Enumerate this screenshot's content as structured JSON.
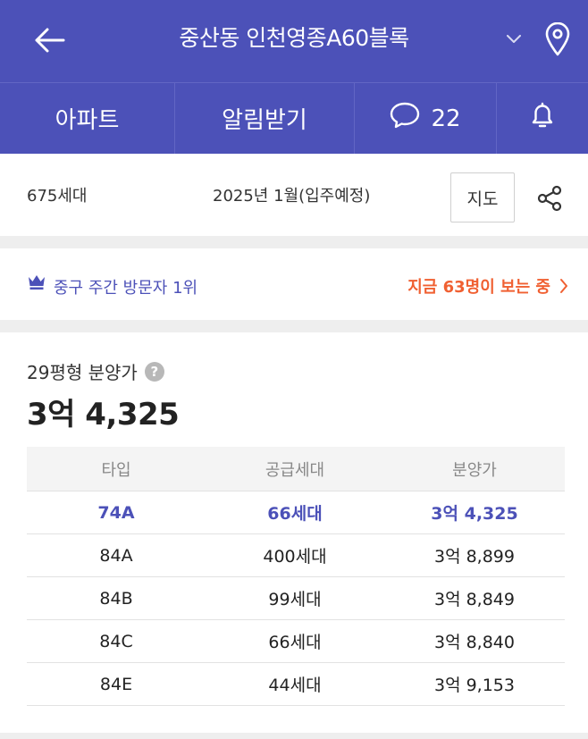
{
  "header": {
    "title": "중산동 인천영종A60블록",
    "back_icon": "back-arrow-icon",
    "dropdown_icon": "chevron-down-icon",
    "location_icon": "location-pin-icon",
    "bg_color": "#4c51b8"
  },
  "tabs": [
    {
      "label": "아파트"
    },
    {
      "label": "알림받기"
    },
    {
      "label": "",
      "count": "22",
      "icon": "chat-bubble-icon"
    },
    {
      "label": "",
      "icon": "bell-icon"
    }
  ],
  "info": {
    "units": "675세대",
    "move_in": "2025년 1월(입주예정)",
    "map_button": "지도",
    "share_icon": "share-icon"
  },
  "ranking": {
    "text": "중구 주간 방문자 1위",
    "viewers": "지금 63명이 보는 중",
    "accent_color": "#4c51b8",
    "viewers_color": "#f06032"
  },
  "price": {
    "label": "29평형 분양가",
    "help_icon": "question-icon",
    "help_glyph": "?",
    "value": "3억 4,325"
  },
  "table": {
    "headers": [
      "타입",
      "공급세대",
      "분양가"
    ],
    "rows": [
      {
        "type": "74A",
        "units": "66세대",
        "price": "3억 4,325",
        "highlight": true
      },
      {
        "type": "84A",
        "units": "400세대",
        "price": "3억 8,899",
        "highlight": false
      },
      {
        "type": "84B",
        "units": "99세대",
        "price": "3억 8,849",
        "highlight": false
      },
      {
        "type": "84C",
        "units": "66세대",
        "price": "3억 8,840",
        "highlight": false
      },
      {
        "type": "84E",
        "units": "44세대",
        "price": "3억 9,153",
        "highlight": false
      }
    ]
  }
}
